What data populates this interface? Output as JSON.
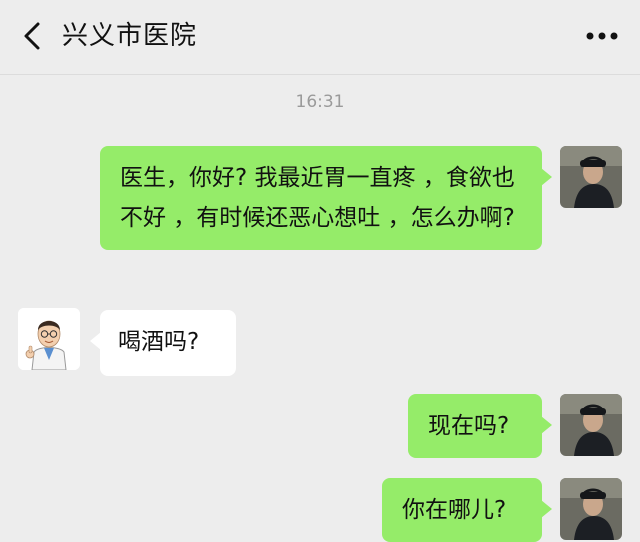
{
  "header": {
    "title": "兴义市医院",
    "back_icon": "chevron-left-icon",
    "more_icon": "more-dots-icon"
  },
  "chat": {
    "timestamp": "16:31",
    "messages": [
      {
        "sender": "me",
        "text": "医生，你好? 我最近胃一直疼 ，食欲也不好 ，有时候还恶心想吐 ，怎么办啊?"
      },
      {
        "sender": "doctor",
        "text": "喝酒吗?"
      },
      {
        "sender": "me",
        "text": "现在吗?"
      },
      {
        "sender": "me",
        "text": "你在哪儿?"
      }
    ]
  },
  "colors": {
    "background": "#ededed",
    "my_bubble": "#95ec69",
    "their_bubble": "#ffffff",
    "timestamp": "#9a9a9a"
  }
}
